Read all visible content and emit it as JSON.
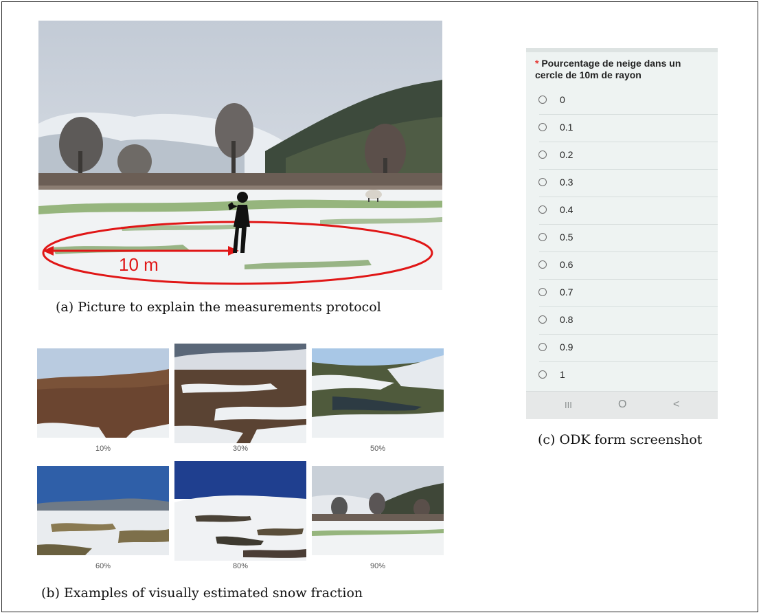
{
  "main_picture": {
    "scale_label": "10 m",
    "caption": "(a) Picture to explain the measurements protocol"
  },
  "examples": {
    "caption": "(b) Examples of visually estimated snow fraction",
    "thumbnails": [
      {
        "label": "10%"
      },
      {
        "label": "30%"
      },
      {
        "label": "50%"
      },
      {
        "label": "60%"
      },
      {
        "label": "80%"
      },
      {
        "label": "90%"
      }
    ]
  },
  "odk_form": {
    "caption": "(c) ODK form screenshot",
    "required_marker": "*",
    "question": "Pourcentage de neige dans un cercle de 10m de rayon",
    "options": [
      "0",
      "0.1",
      "0.2",
      "0.3",
      "0.4",
      "0.5",
      "0.6",
      "0.7",
      "0.8",
      "0.9",
      "1"
    ],
    "nav": {
      "recent": "III",
      "home": "O",
      "back": "<"
    }
  },
  "colors": {
    "measure_red": "#e01616",
    "required_red": "#e53935",
    "form_background": "#eef3f2",
    "snow": "#f1f3f4",
    "grass": "#5e8b3a"
  }
}
